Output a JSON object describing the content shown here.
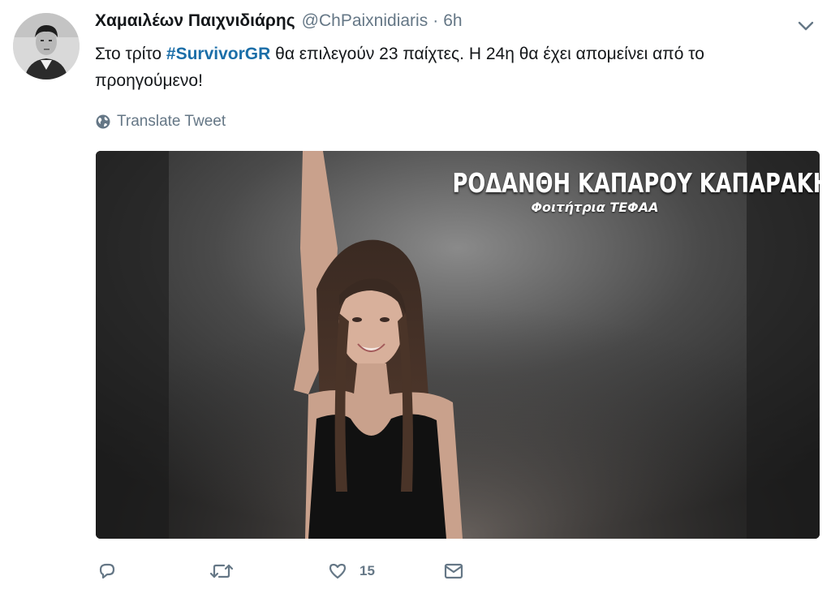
{
  "tweet": {
    "display_name": "Χαμαιλέων Παιχνιδιάρης",
    "handle": "@ChPaixnidiaris",
    "separator": "·",
    "time": "6h",
    "text_before": "Στο τρίτο ",
    "hashtag": "#SurvivorGR",
    "text_after": " θα επιλεγούν 23 παίχτες. Η 24η θα έχει απομείνει από το προηγούμενο!",
    "translate_label": "Translate Tweet"
  },
  "media": {
    "caption_name": "ΡΟΔΑΝΘΗ ΚΑΠΑΡΟΥ ΚΑΠΑΡΑΚΗ",
    "caption_sub": "Φοιτήτρια ΤΕΦΑΑ"
  },
  "actions": {
    "reply_icon": "reply-icon",
    "retweet_icon": "retweet-icon",
    "like_icon": "heart-icon",
    "like_count": "15",
    "dm_icon": "envelope-icon"
  },
  "colors": {
    "hashtag": "#1b6ea8",
    "muted": "#657786",
    "text": "#14171a"
  }
}
